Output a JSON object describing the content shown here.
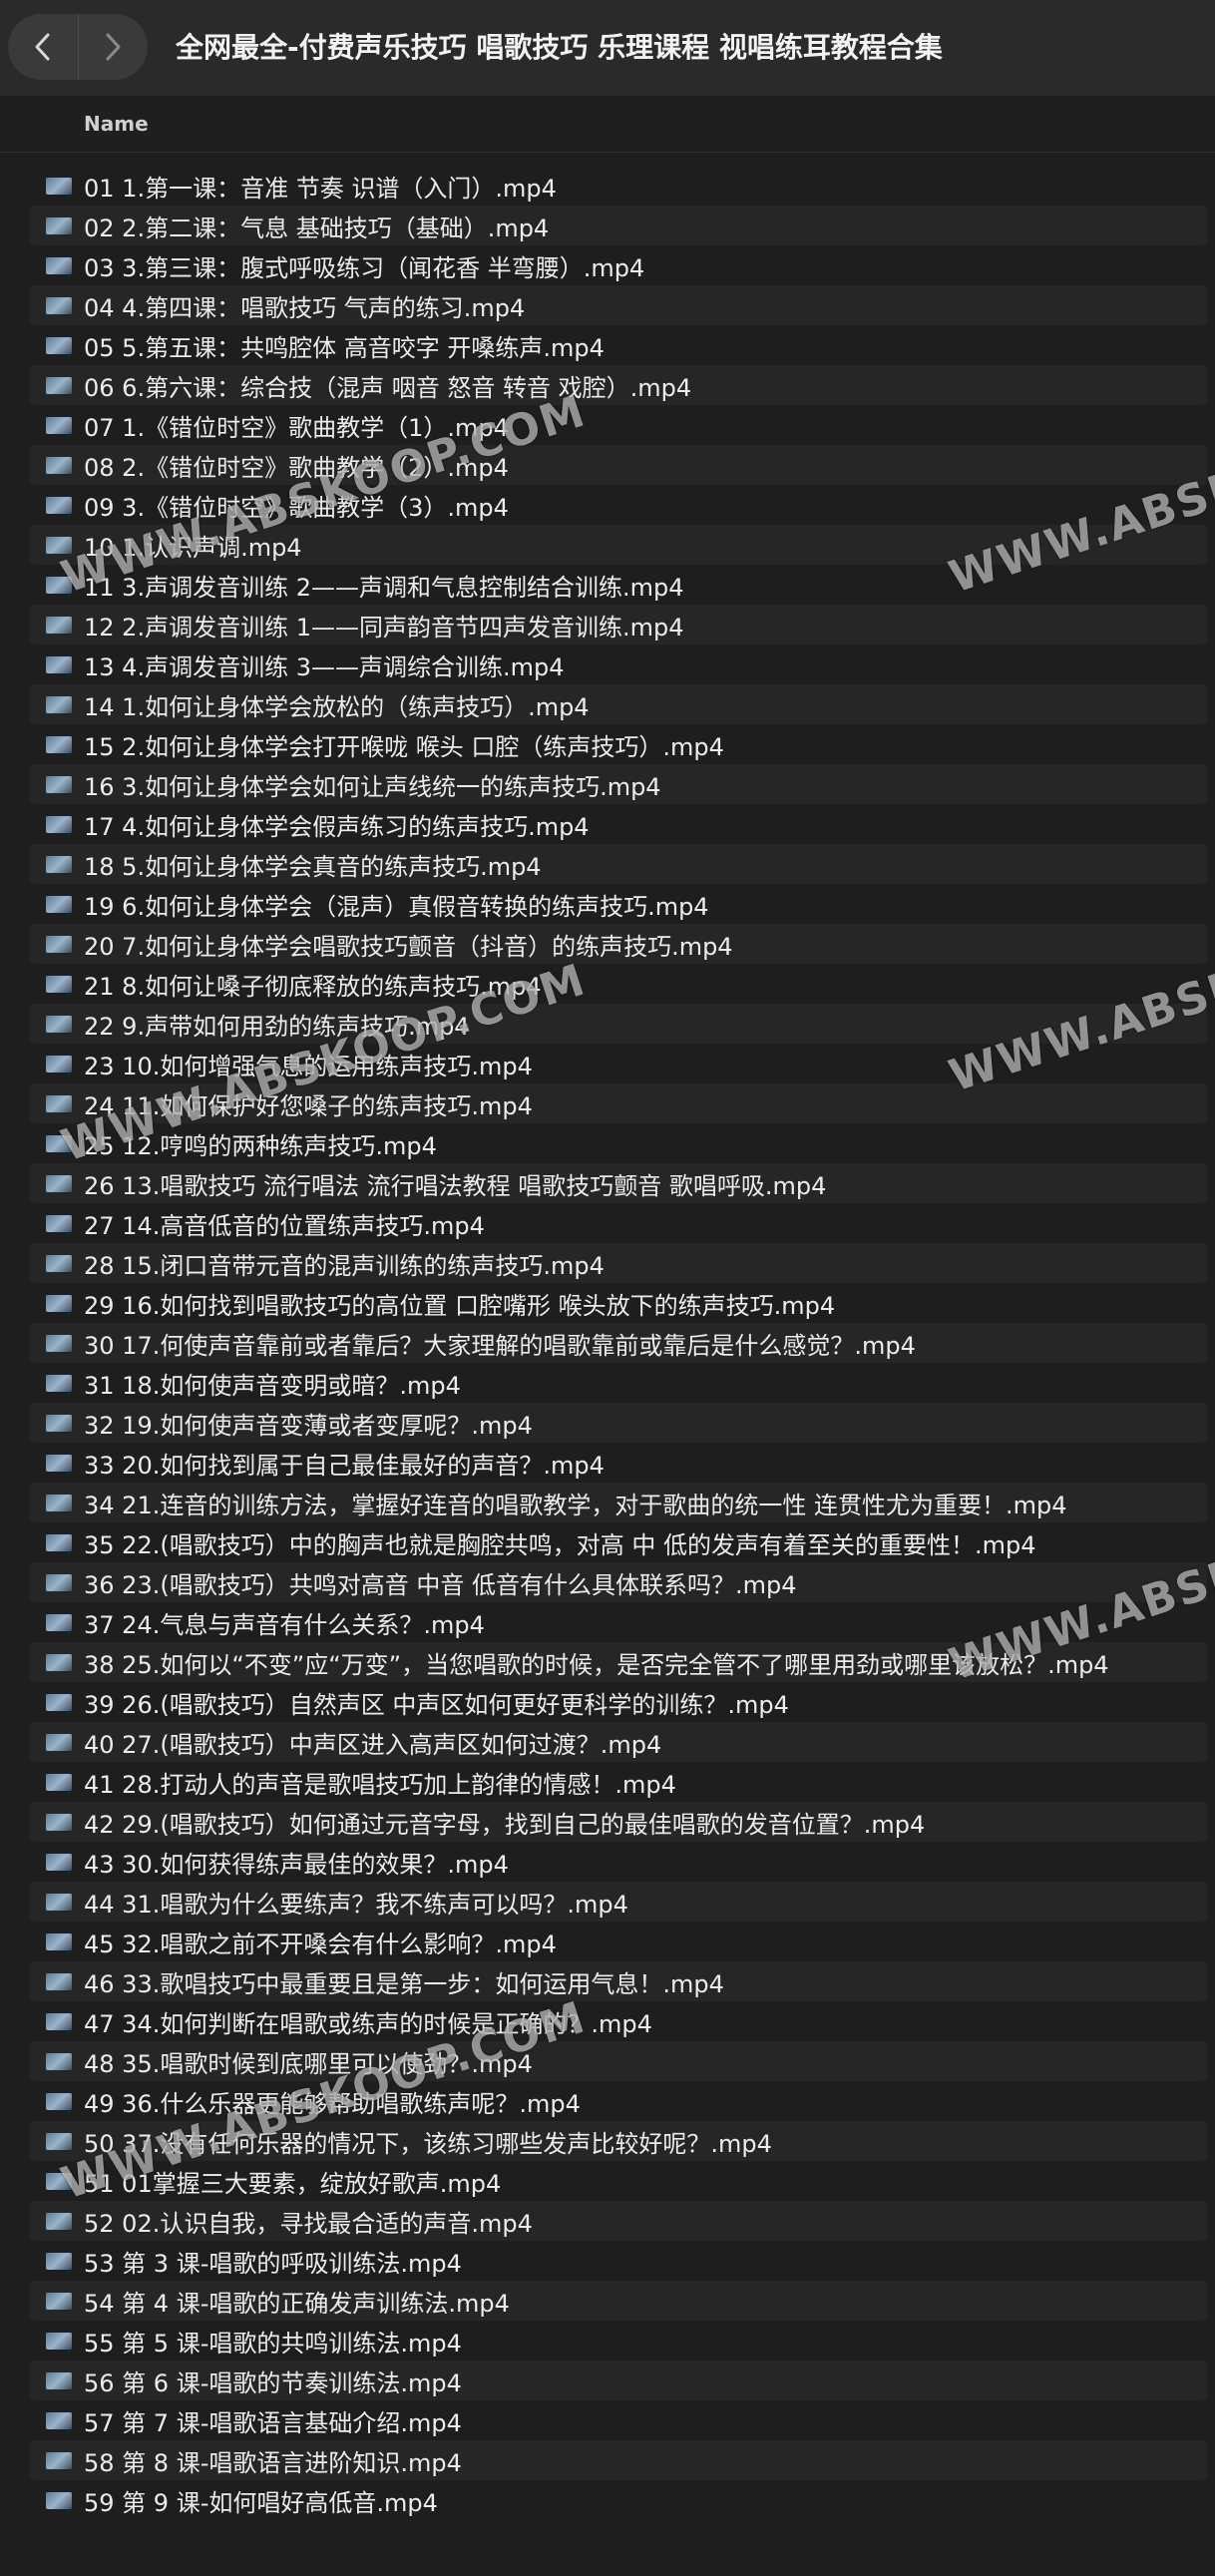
{
  "window": {
    "title": "全网最全-付费声乐技巧 唱歌技巧 乐理课程 视唱练耳教程合集",
    "back_icon": "‹",
    "forward_icon": "›"
  },
  "columns": {
    "name": "Name"
  },
  "watermark": "WWW.ABSKOOP.COM",
  "files": [
    "01 1.第一课：音准 节奏 识谱（入门）.mp4",
    "02 2.第二课：气息 基础技巧（基础）.mp4",
    "03 3.第三课：腹式呼吸练习（闻花香 半弯腰）.mp4",
    "04 4.第四课：唱歌技巧 气声的练习.mp4",
    "05 5.第五课：共鸣腔体 高音咬字 开嗓练声.mp4",
    "06 6.第六课：综合技（混声 咽音 怒音 转音 戏腔）.mp4",
    "07 1.《错位时空》歌曲教学（1）.mp4",
    "08 2.《错位时空》歌曲教学（2）.mp4",
    "09 3.《错位时空》歌曲教学（3）.mp4",
    "10 1.认识声调.mp4",
    "11 3.声调发音训练 2——声调和气息控制结合训练.mp4",
    "12 2.声调发音训练 1——同声韵音节四声发音训练.mp4",
    "13 4.声调发音训练 3——声调综合训练.mp4",
    "14 1.如何让身体学会放松的（练声技巧）.mp4",
    "15 2.如何让身体学会打开喉咙 喉头 口腔（练声技巧）.mp4",
    "16 3.如何让身体学会如何让声线统一的练声技巧.mp4",
    "17 4.如何让身体学会假声练习的练声技巧.mp4",
    "18 5.如何让身体学会真音的练声技巧.mp4",
    "19 6.如何让身体学会（混声）真假音转换的练声技巧.mp4",
    "20 7.如何让身体学会唱歌技巧颤音（抖音）的练声技巧.mp4",
    "21 8.如何让嗓子彻底释放的练声技巧.mp4",
    "22 9.声带如何用劲的练声技巧.mp4",
    "23 10.如何增强气息的运用练声技巧.mp4",
    "24 11.如何保护好您嗓子的练声技巧.mp4",
    "25 12.哼鸣的两种练声技巧.mp4",
    "26 13.唱歌技巧 流行唱法 流行唱法教程 唱歌技巧颤音 歌唱呼吸.mp4",
    "27 14.高音低音的位置练声技巧.mp4",
    "28 15.闭口音带元音的混声训练的练声技巧.mp4",
    "29 16.如何找到唱歌技巧的高位置 口腔嘴形 喉头放下的练声技巧.mp4",
    "30 17.何使声音靠前或者靠后？大家理解的唱歌靠前或靠后是什么感觉？.mp4",
    "31 18.如何使声音变明或暗？.mp4",
    "32 19.如何使声音变薄或者变厚呢？.mp4",
    "33 20.如何找到属于自己最佳最好的声音？.mp4",
    "34 21.连音的训练方法，掌握好连音的唱歌教学，对于歌曲的统一性 连贯性尤为重要！.mp4",
    "35 22.(唱歌技巧）中的胸声也就是胸腔共鸣，对高 中 低的发声有着至关的重要性！.mp4",
    "36 23.(唱歌技巧）共鸣对高音 中音 低音有什么具体联系吗？.mp4",
    "37 24.气息与声音有什么关系？.mp4",
    "38 25.如何以“不变”应“万变”，当您唱歌的时候，是否完全管不了哪里用劲或哪里该放松？.mp4",
    "39 26.(唱歌技巧）自然声区 中声区如何更好更科学的训练？.mp4",
    "40 27.(唱歌技巧）中声区进入高声区如何过渡？.mp4",
    "41 28.打动人的声音是歌唱技巧加上韵律的情感！.mp4",
    "42 29.(唱歌技巧）如何通过元音字母，找到自己的最佳唱歌的发音位置？.mp4",
    "43 30.如何获得练声最佳的效果？.mp4",
    "44 31.唱歌为什么要练声？我不练声可以吗？.mp4",
    "45 32.唱歌之前不开嗓会有什么影响？.mp4",
    "46 33.歌唱技巧中最重要且是第一步：如何运用气息！.mp4",
    "47 34.如何判断在唱歌或练声的时候是正确的？.mp4",
    "48 35.唱歌时候到底哪里可以使劲？.mp4",
    "49 36.什么乐器更能够帮助唱歌练声呢？.mp4",
    "50 37.没有任何乐器的情况下，该练习哪些发声比较好呢？.mp4",
    "51 01掌握三大要素，绽放好歌声.mp4",
    "52 02.认识自我，寻找最合适的声音.mp4",
    "53 第 3 课-唱歌的呼吸训练法.mp4",
    "54 第 4 课-唱歌的正确发声训练法.mp4",
    "55 第 5 课-唱歌的共鸣训练法.mp4",
    "56 第 6 课-唱歌的节奏训练法.mp4",
    "57 第 7 课-唱歌语言基础介绍.mp4",
    "58 第 8 课-唱歌语言进阶知识.mp4",
    "59 第 9 课-如何唱好高低音.mp4"
  ]
}
